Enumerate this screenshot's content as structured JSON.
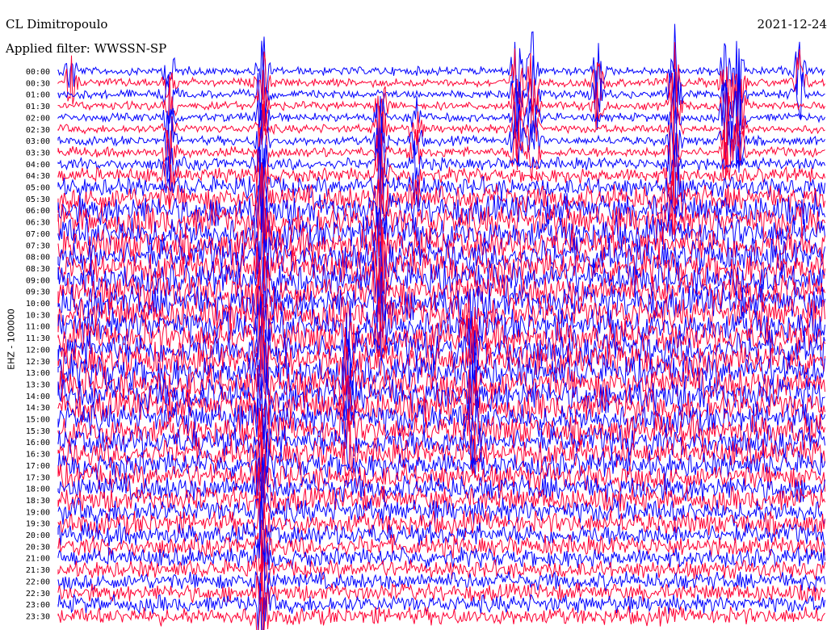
{
  "header": {
    "station": "CL Dimitropoulo",
    "filter": "Applied filter: WWSSN-SP",
    "date": "2021-12-24"
  },
  "chart_data": {
    "type": "helicorder",
    "ylabel": "EHZ - 100000",
    "row_labels": [
      "00:00",
      "00:30",
      "01:00",
      "01:30",
      "02:00",
      "02:30",
      "03:00",
      "03:30",
      "04:00",
      "04:30",
      "05:00",
      "05:30",
      "06:00",
      "06:30",
      "07:00",
      "07:30",
      "08:00",
      "08:30",
      "09:00",
      "09:30",
      "10:00",
      "10:30",
      "11:00",
      "11:30",
      "12:00",
      "12:30",
      "13:00",
      "13:30",
      "14:00",
      "14:30",
      "15:00",
      "15:30",
      "16:00",
      "16:30",
      "17:00",
      "17:30",
      "18:00",
      "18:30",
      "19:00",
      "19:30",
      "20:00",
      "20:30",
      "21:00",
      "21:30",
      "22:00",
      "22:30",
      "23:00",
      "23:30"
    ],
    "trace_colors": [
      "#0000ff",
      "#ff0033"
    ],
    "noise_level": [
      0.12,
      0.12,
      0.12,
      0.12,
      0.12,
      0.12,
      0.14,
      0.18,
      0.25,
      0.35,
      0.5,
      0.75,
      0.9,
      1.0,
      1.0,
      1.0,
      1.0,
      1.0,
      1.0,
      1.0,
      1.0,
      1.0,
      1.0,
      1.0,
      1.0,
      1.0,
      1.0,
      1.0,
      1.0,
      0.95,
      0.9,
      0.9,
      0.85,
      0.8,
      0.75,
      0.75,
      0.75,
      0.7,
      0.7,
      0.65,
      0.6,
      0.55,
      0.5,
      0.45,
      0.45,
      0.45,
      0.45,
      0.45
    ]
  }
}
